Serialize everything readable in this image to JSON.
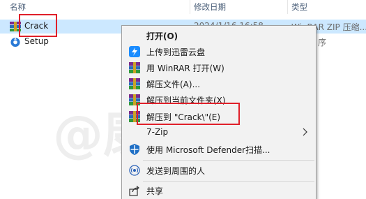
{
  "columns": {
    "name": "名称",
    "date": "修改日期",
    "type": "类型"
  },
  "files": [
    {
      "name": "Crack",
      "date": "2024/1/16 16:58",
      "type": "WinRAR ZIP 压缩...",
      "icon": "winrar-archive-icon"
    },
    {
      "name": "Setup",
      "date": "",
      "type": "序",
      "icon": "setup-app-icon"
    }
  ],
  "context_menu": {
    "open": "打开(O)",
    "upload_thunder": "上传到迅雷云盘",
    "open_winrar": "用 WinRAR 打开(W)",
    "extract_files": "解压文件(A)...",
    "extract_here": "解压到当前文件夹(X)",
    "extract_to": "解压到 \"Crack\\\"(E)",
    "sevenzip": "7-Zip",
    "defender_scan": "使用 Microsoft Defender扫描...",
    "send_nearby": "发送到周围的人",
    "share": "共享"
  },
  "watermark": "@康王风",
  "colors": {
    "selection": "#cce8ff",
    "highlight_box": "#e0202a",
    "menu_bg": "#f2f2f2"
  }
}
